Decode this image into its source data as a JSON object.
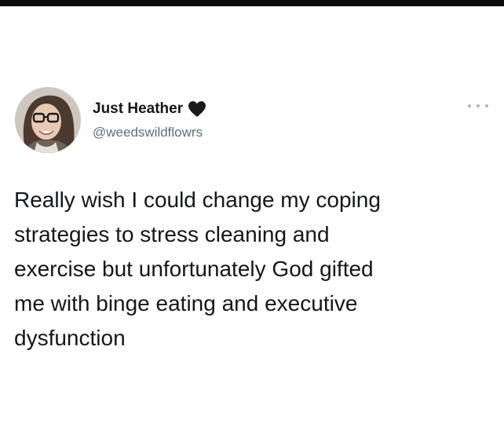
{
  "tweet": {
    "author": {
      "display_name": "Just Heather",
      "handle": "@weedswildflowrs",
      "avatar_icon": "user-avatar-photo",
      "badge_icon": "black-heart-icon"
    },
    "more_icon": "more-options-icon",
    "text_lines": [
      "Really wish I could change my coping",
      "strategies to stress cleaning and",
      "exercise but unfortunately God gifted",
      "me with binge eating and executive",
      "dysfunction"
    ]
  },
  "colors": {
    "text": "#14171a",
    "handle": "#5b7083",
    "more_dots": "#aab8c2",
    "top_bar": "#0b0b0b",
    "background": "#ffffff"
  }
}
